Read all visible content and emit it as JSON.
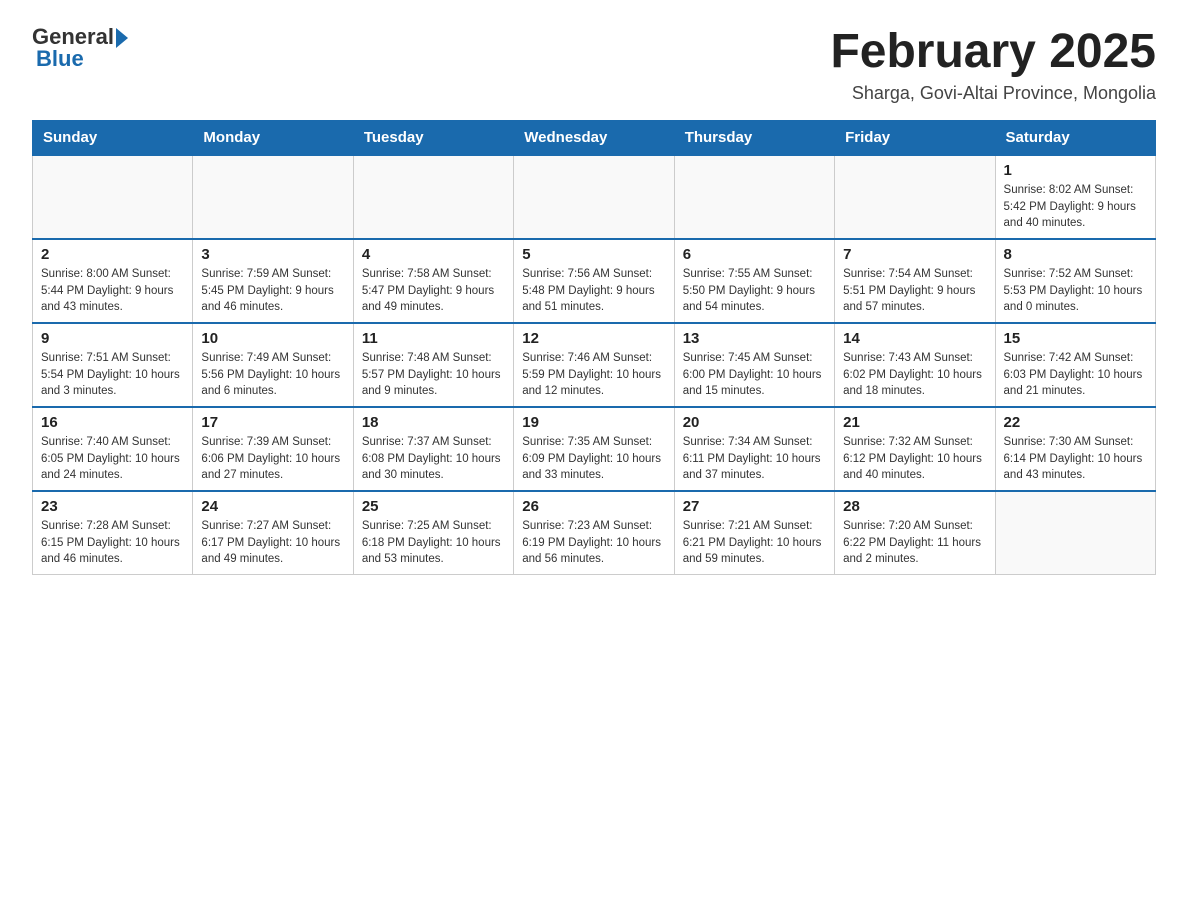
{
  "header": {
    "logo_general": "General",
    "logo_blue": "Blue",
    "title": "February 2025",
    "subtitle": "Sharga, Govi-Altai Province, Mongolia"
  },
  "days_of_week": [
    "Sunday",
    "Monday",
    "Tuesday",
    "Wednesday",
    "Thursday",
    "Friday",
    "Saturday"
  ],
  "weeks": [
    [
      {
        "day": "",
        "info": ""
      },
      {
        "day": "",
        "info": ""
      },
      {
        "day": "",
        "info": ""
      },
      {
        "day": "",
        "info": ""
      },
      {
        "day": "",
        "info": ""
      },
      {
        "day": "",
        "info": ""
      },
      {
        "day": "1",
        "info": "Sunrise: 8:02 AM\nSunset: 5:42 PM\nDaylight: 9 hours\nand 40 minutes."
      }
    ],
    [
      {
        "day": "2",
        "info": "Sunrise: 8:00 AM\nSunset: 5:44 PM\nDaylight: 9 hours\nand 43 minutes."
      },
      {
        "day": "3",
        "info": "Sunrise: 7:59 AM\nSunset: 5:45 PM\nDaylight: 9 hours\nand 46 minutes."
      },
      {
        "day": "4",
        "info": "Sunrise: 7:58 AM\nSunset: 5:47 PM\nDaylight: 9 hours\nand 49 minutes."
      },
      {
        "day": "5",
        "info": "Sunrise: 7:56 AM\nSunset: 5:48 PM\nDaylight: 9 hours\nand 51 minutes."
      },
      {
        "day": "6",
        "info": "Sunrise: 7:55 AM\nSunset: 5:50 PM\nDaylight: 9 hours\nand 54 minutes."
      },
      {
        "day": "7",
        "info": "Sunrise: 7:54 AM\nSunset: 5:51 PM\nDaylight: 9 hours\nand 57 minutes."
      },
      {
        "day": "8",
        "info": "Sunrise: 7:52 AM\nSunset: 5:53 PM\nDaylight: 10 hours\nand 0 minutes."
      }
    ],
    [
      {
        "day": "9",
        "info": "Sunrise: 7:51 AM\nSunset: 5:54 PM\nDaylight: 10 hours\nand 3 minutes."
      },
      {
        "day": "10",
        "info": "Sunrise: 7:49 AM\nSunset: 5:56 PM\nDaylight: 10 hours\nand 6 minutes."
      },
      {
        "day": "11",
        "info": "Sunrise: 7:48 AM\nSunset: 5:57 PM\nDaylight: 10 hours\nand 9 minutes."
      },
      {
        "day": "12",
        "info": "Sunrise: 7:46 AM\nSunset: 5:59 PM\nDaylight: 10 hours\nand 12 minutes."
      },
      {
        "day": "13",
        "info": "Sunrise: 7:45 AM\nSunset: 6:00 PM\nDaylight: 10 hours\nand 15 minutes."
      },
      {
        "day": "14",
        "info": "Sunrise: 7:43 AM\nSunset: 6:02 PM\nDaylight: 10 hours\nand 18 minutes."
      },
      {
        "day": "15",
        "info": "Sunrise: 7:42 AM\nSunset: 6:03 PM\nDaylight: 10 hours\nand 21 minutes."
      }
    ],
    [
      {
        "day": "16",
        "info": "Sunrise: 7:40 AM\nSunset: 6:05 PM\nDaylight: 10 hours\nand 24 minutes."
      },
      {
        "day": "17",
        "info": "Sunrise: 7:39 AM\nSunset: 6:06 PM\nDaylight: 10 hours\nand 27 minutes."
      },
      {
        "day": "18",
        "info": "Sunrise: 7:37 AM\nSunset: 6:08 PM\nDaylight: 10 hours\nand 30 minutes."
      },
      {
        "day": "19",
        "info": "Sunrise: 7:35 AM\nSunset: 6:09 PM\nDaylight: 10 hours\nand 33 minutes."
      },
      {
        "day": "20",
        "info": "Sunrise: 7:34 AM\nSunset: 6:11 PM\nDaylight: 10 hours\nand 37 minutes."
      },
      {
        "day": "21",
        "info": "Sunrise: 7:32 AM\nSunset: 6:12 PM\nDaylight: 10 hours\nand 40 minutes."
      },
      {
        "day": "22",
        "info": "Sunrise: 7:30 AM\nSunset: 6:14 PM\nDaylight: 10 hours\nand 43 minutes."
      }
    ],
    [
      {
        "day": "23",
        "info": "Sunrise: 7:28 AM\nSunset: 6:15 PM\nDaylight: 10 hours\nand 46 minutes."
      },
      {
        "day": "24",
        "info": "Sunrise: 7:27 AM\nSunset: 6:17 PM\nDaylight: 10 hours\nand 49 minutes."
      },
      {
        "day": "25",
        "info": "Sunrise: 7:25 AM\nSunset: 6:18 PM\nDaylight: 10 hours\nand 53 minutes."
      },
      {
        "day": "26",
        "info": "Sunrise: 7:23 AM\nSunset: 6:19 PM\nDaylight: 10 hours\nand 56 minutes."
      },
      {
        "day": "27",
        "info": "Sunrise: 7:21 AM\nSunset: 6:21 PM\nDaylight: 10 hours\nand 59 minutes."
      },
      {
        "day": "28",
        "info": "Sunrise: 7:20 AM\nSunset: 6:22 PM\nDaylight: 11 hours\nand 2 minutes."
      },
      {
        "day": "",
        "info": ""
      }
    ]
  ]
}
